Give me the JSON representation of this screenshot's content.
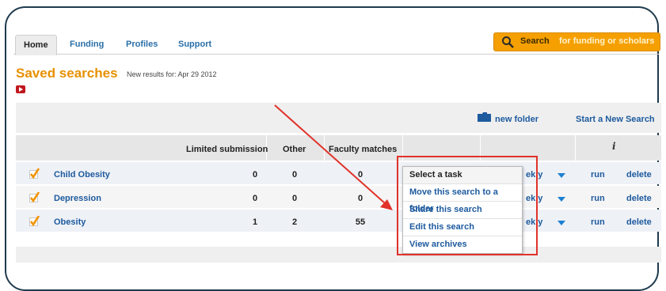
{
  "nav": {
    "tabs": [
      {
        "label": "Home",
        "active": true
      },
      {
        "label": "Funding"
      },
      {
        "label": "Profiles"
      },
      {
        "label": "Support"
      }
    ],
    "search_button": {
      "label": "Search",
      "sublabel": "for funding or scholars",
      "color": "#f5a000"
    }
  },
  "page": {
    "title": "Saved searches",
    "new_results": "New results for: Apr 29 2012"
  },
  "toolbar": {
    "new_folder": "new folder",
    "start_new": "Start a New Search"
  },
  "table": {
    "headers": [
      "Limited submission",
      "Other",
      "Faculty matches"
    ],
    "info_icon": "i",
    "rows": [
      {
        "name": "Child Obesity",
        "limited": "0",
        "other": "0",
        "faculty": "0",
        "freq": "ekly",
        "run": "run",
        "delete": "delete"
      },
      {
        "name": "Depression",
        "limited": "0",
        "other": "0",
        "faculty": "0",
        "freq": "ekly",
        "run": "run",
        "delete": "delete"
      },
      {
        "name": "Obesity",
        "limited": "1",
        "other": "2",
        "faculty": "55",
        "freq": "ekly",
        "run": "run",
        "delete": "delete"
      }
    ]
  },
  "menu": {
    "items": [
      "Select a task",
      "Move this search to a folder",
      "Share this search",
      "Edit this search",
      "View archives"
    ]
  },
  "colors": {
    "accent": "#e79000",
    "link": "#1d5a9e",
    "annotation": "#e0322a"
  }
}
